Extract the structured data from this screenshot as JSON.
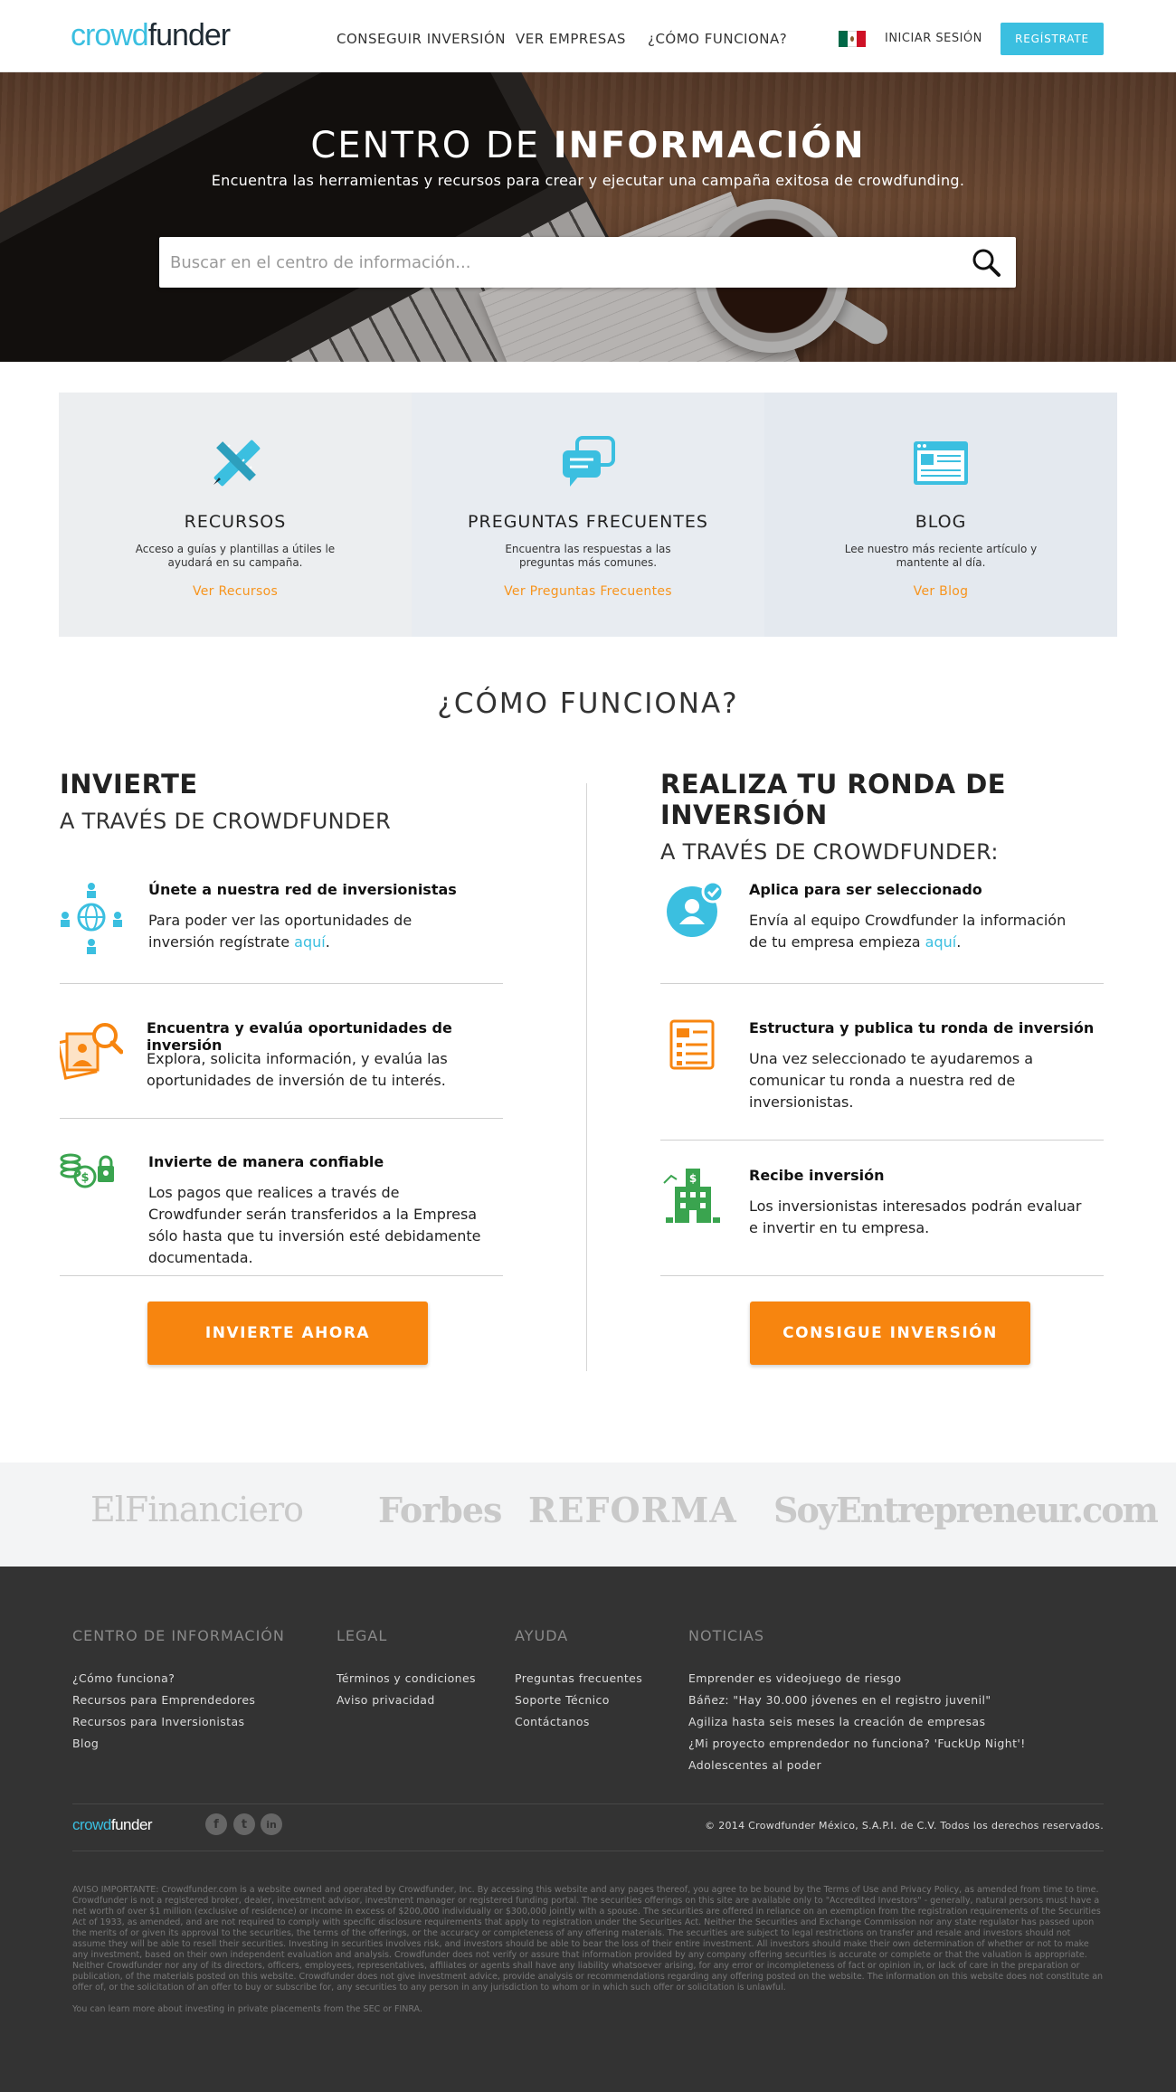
{
  "header": {
    "logo_part1": "crowd",
    "logo_part2": "funder",
    "nav": [
      "CONSEGUIR INVERSIÓN",
      "VER EMPRESAS",
      "¿CÓMO FUNCIONA?"
    ],
    "login_label": "INICIAR SESIÓN",
    "register_label": "REGÍSTRATE",
    "accent_color": "#3bbfe0"
  },
  "hero": {
    "title_light": "CENTRO DE",
    "title_bold": "INFORMACIÓN",
    "subtitle": "Encuentra las herramientas y recursos para crear y ejecutar una campaña exitosa de crowdfunding.",
    "search_placeholder": "Buscar en el centro de información..."
  },
  "cards": [
    {
      "icon": "pencil-ruler-icon",
      "title": "RECURSOS",
      "text": "Acceso a guías y plantillas a útiles le ayudará en su campaña.",
      "link": "Ver Recursos"
    },
    {
      "icon": "chat-bubbles-icon",
      "title": "PREGUNTAS FRECUENTES",
      "text": "Encuentra las respuestas a las preguntas más comunes.",
      "link": "Ver Preguntas Frecuentes"
    },
    {
      "icon": "browser-window-icon",
      "title": "BLOG",
      "text": "Lee nuestro más reciente artículo y mantente al día.",
      "link": "Ver Blog"
    }
  ],
  "how": {
    "title": "¿CÓMO FUNCIONA?",
    "invest": {
      "heading": "INVIERTE",
      "subheading": "A TRAVÉS DE CROWDFUNDER",
      "steps": [
        {
          "icon": "network-globe-icon",
          "title": "Únete a nuestra red de inversionistas",
          "text": "Para poder ver las oportunidades de inversión regístrate ",
          "link": "aquí",
          "end": "."
        },
        {
          "icon": "magnifier-photos-icon",
          "title": "Encuentra y evalúa oportunidades de inversión",
          "text": "Explora, solicita información, y evalúa las oportunidades de inversión de tu interés."
        },
        {
          "icon": "coins-lock-icon",
          "title": "Invierte de manera confiable",
          "text": "Los pagos que realices a través de Crowdfunder serán transferidos a la Empresa sólo hasta que tu inversión esté debidamente documentada."
        }
      ],
      "cta": "INVIERTE AHORA"
    },
    "raise": {
      "heading": "REALIZA TU RONDA DE INVERSIÓN",
      "subheading": "A TRAVÉS DE CROWDFUNDER:",
      "steps": [
        {
          "icon": "user-check-icon",
          "title": "Aplica para ser seleccionado",
          "text": "Envía al equipo Crowdfunder la información de tu empresa empieza ",
          "link": "aquí",
          "end": "."
        },
        {
          "icon": "document-list-icon",
          "title": "Estructura y publica tu ronda de inversión",
          "text": "Una vez seleccionado te ayudaremos a comunicar tu ronda a nuestra red de inversionistas."
        },
        {
          "icon": "building-growth-icon",
          "title": "Recibe inversión",
          "text": "Los inversionistas interesados podrán evaluar e invertir en tu empresa."
        }
      ],
      "cta": "CONSIGUE INVERSIÓN"
    },
    "cta_color": "#f7850f"
  },
  "press": [
    "ElFinanciero",
    "Forbes",
    "REFORMA",
    "SoyEntrepreneur.com"
  ],
  "footer": {
    "columns": [
      {
        "title": "CENTRO DE INFORMACIÓN",
        "links": [
          "¿Cómo funciona?",
          "Recursos para Emprendedores",
          "Recursos para Inversionistas",
          "Blog"
        ]
      },
      {
        "title": "LEGAL",
        "links": [
          "Términos y condiciones",
          "Aviso privacidad"
        ]
      },
      {
        "title": "AYUDA",
        "links": [
          "Preguntas frecuentes",
          "Soporte Técnico",
          "Contáctanos"
        ]
      },
      {
        "title": "NOTICIAS",
        "links": [
          "Emprender es videojuego de riesgo",
          "Báñez: \"Hay 30.000 jóvenes en el registro juvenil\"",
          "Agiliza hasta seis meses la creación de empresas",
          "¿Mi proyecto emprendedor no funciona? 'FuckUp Night'!",
          "Adolescentes al poder"
        ]
      }
    ],
    "logo_part1": "crowd",
    "logo_part2": "funder",
    "social": [
      "f",
      "t",
      "in"
    ],
    "copyright": "© 2014 Crowdfunder México, S.A.P.I. de C.V. Todos los derechos reservados.",
    "legal": "AVISO IMPORTANTE: Crowdfunder.com is a website owned and operated by Crowdfunder, Inc. By accessing this website and any pages thereof, you agree to be bound by the Terms of Use and Privacy Policy, as amended from time to time. Crowdfunder is not a registered broker, dealer, investment advisor, investment manager or registered funding portal. The securities offerings on this site are available only to \"Accredited Investors\" - generally, natural persons must have a net worth of over $1 million (exclusive of residence) or income in excess of $200,000 individually or $300,000 jointly with a spouse. The securities are offered in reliance on an exemption from the registration requirements of the Securities Act of 1933, as amended, and are not required to comply with specific disclosure requirements that apply to registration under the Securities Act. Neither the Securities and Exchange Commission nor any state regulator has passed upon the merits of or given its approval to the securities, the terms of the offerings, or the accuracy or completeness of any offering materials. The securities are subject to legal restrictions on transfer and resale and investors should not assume they will be able to resell their securities. Investing in securities involves risk, and investors should be able to bear the loss of their entire investment. All investors should make their own determination of whether or not to make any investment, based on their own independent evaluation and analysis. Crowdfunder does not verify or assure that information provided by any company offering securities is accurate or complete or that the valuation is appropriate. Neither Crowdfunder nor any of its directors, officers, employees, representatives, affiliates or agents shall have any liability whatsoever arising, for any error or incompleteness of fact or opinion in, or lack of care in the preparation or publication, of the materials posted on this website. Crowdfunder does not give investment advice, provide analysis or recommendations regarding any offering posted on the website. The information on this website does not constitute an offer of, or the solicitation of an offer to buy or subscribe for, any securities to any person in any jurisdiction to whom or in which such offer or solicitation is unlawful.",
    "legal2": "You can learn more about investing in private placements from the SEC or FINRA."
  }
}
